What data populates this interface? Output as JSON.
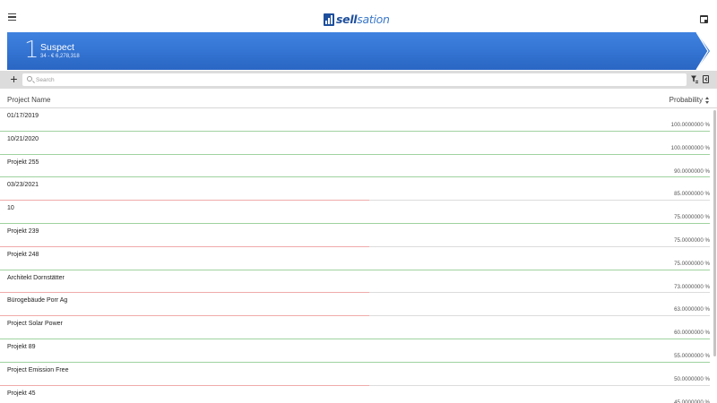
{
  "app": {
    "logo_part_a": "sell",
    "logo_part_b": "sation",
    "brand_color": "#1e4f9c"
  },
  "header": {
    "menu_icon": "hamburger-menu-icon",
    "calendar_icon": "calendar-icon"
  },
  "stage": {
    "number": "1",
    "name": "Suspect",
    "summary": "34 - € 6,278,318",
    "color": "#2f6fd1"
  },
  "toolbar": {
    "add_label": "+",
    "search_placeholder": "Search",
    "filter_icon": "filter-settings-icon",
    "export_icon": "export-icon"
  },
  "table": {
    "col_name": "Project Name",
    "col_probability": "Probability",
    "sort_icon": "sort-icon",
    "rows": [
      {
        "name": "01/17/2019",
        "probability": "100.0000000 %",
        "indicator": "green"
      },
      {
        "name": "10/21/2020",
        "probability": "100.0000000 %",
        "indicator": "green"
      },
      {
        "name": "Projekt 255",
        "probability": "90.0000000 %",
        "indicator": "green"
      },
      {
        "name": "03/23/2021",
        "probability": "85.0000000 %",
        "indicator": "red"
      },
      {
        "name": "10",
        "probability": "75.0000000 %",
        "indicator": "green"
      },
      {
        "name": "Projekt 239",
        "probability": "75.0000000 %",
        "indicator": "red"
      },
      {
        "name": "Projekt 248",
        "probability": "75.0000000 %",
        "indicator": "green"
      },
      {
        "name": "Architekt Dornstätter",
        "probability": "73.0000000 %",
        "indicator": "red"
      },
      {
        "name": "Bürogebäude Porr Ag",
        "probability": "63.0000000 %",
        "indicator": "red"
      },
      {
        "name": "Project Solar Power",
        "probability": "60.0000000 %",
        "indicator": "green"
      },
      {
        "name": "Projekt 89",
        "probability": "55.0000000 %",
        "indicator": "green"
      },
      {
        "name": "Project Emission Free",
        "probability": "50.0000000 %",
        "indicator": "red"
      },
      {
        "name": "Projekt 45",
        "probability": "45.0000000 %",
        "indicator": "green"
      }
    ]
  }
}
